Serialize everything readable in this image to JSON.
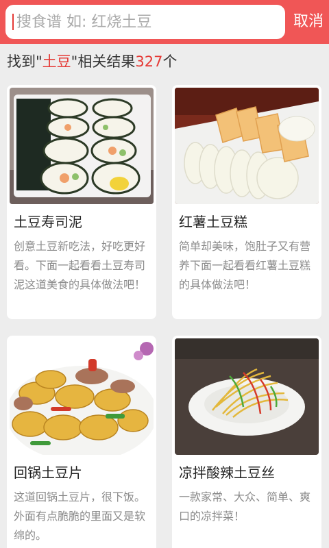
{
  "search": {
    "placeholder": "搜食谱 如: 红烧土豆",
    "cancel_label": "取消"
  },
  "result": {
    "prefix": "找到\"",
    "keyword": "土豆",
    "middle": "\"相关结果",
    "count": "327",
    "suffix": "个"
  },
  "recipes": [
    {
      "title": "土豆寿司泥",
      "description": "创意土豆新吃法，好吃更好看。下面一起看看土豆寿司泥这道美食的具体做法吧！",
      "image": "sushi-rolls-photo"
    },
    {
      "title": "红薯土豆糕",
      "description": "简单却美味，饱肚子又有营养下面一起看看红薯土豆糕的具体做法吧！",
      "image": "sweet-potato-cake-photo"
    },
    {
      "title": "回锅土豆片",
      "description": "这道回锅土豆片，很下饭。外面有点脆脆的里面又是软绵的。",
      "image": "twice-cooked-potato-photo"
    },
    {
      "title": "凉拌酸辣土豆丝",
      "description": "一款家常、大众、简单、爽口的凉拌菜！",
      "image": "shredded-potato-salad-photo"
    }
  ],
  "colors": {
    "header": "#f05656",
    "accent": "#e53935",
    "background": "#ededed"
  }
}
